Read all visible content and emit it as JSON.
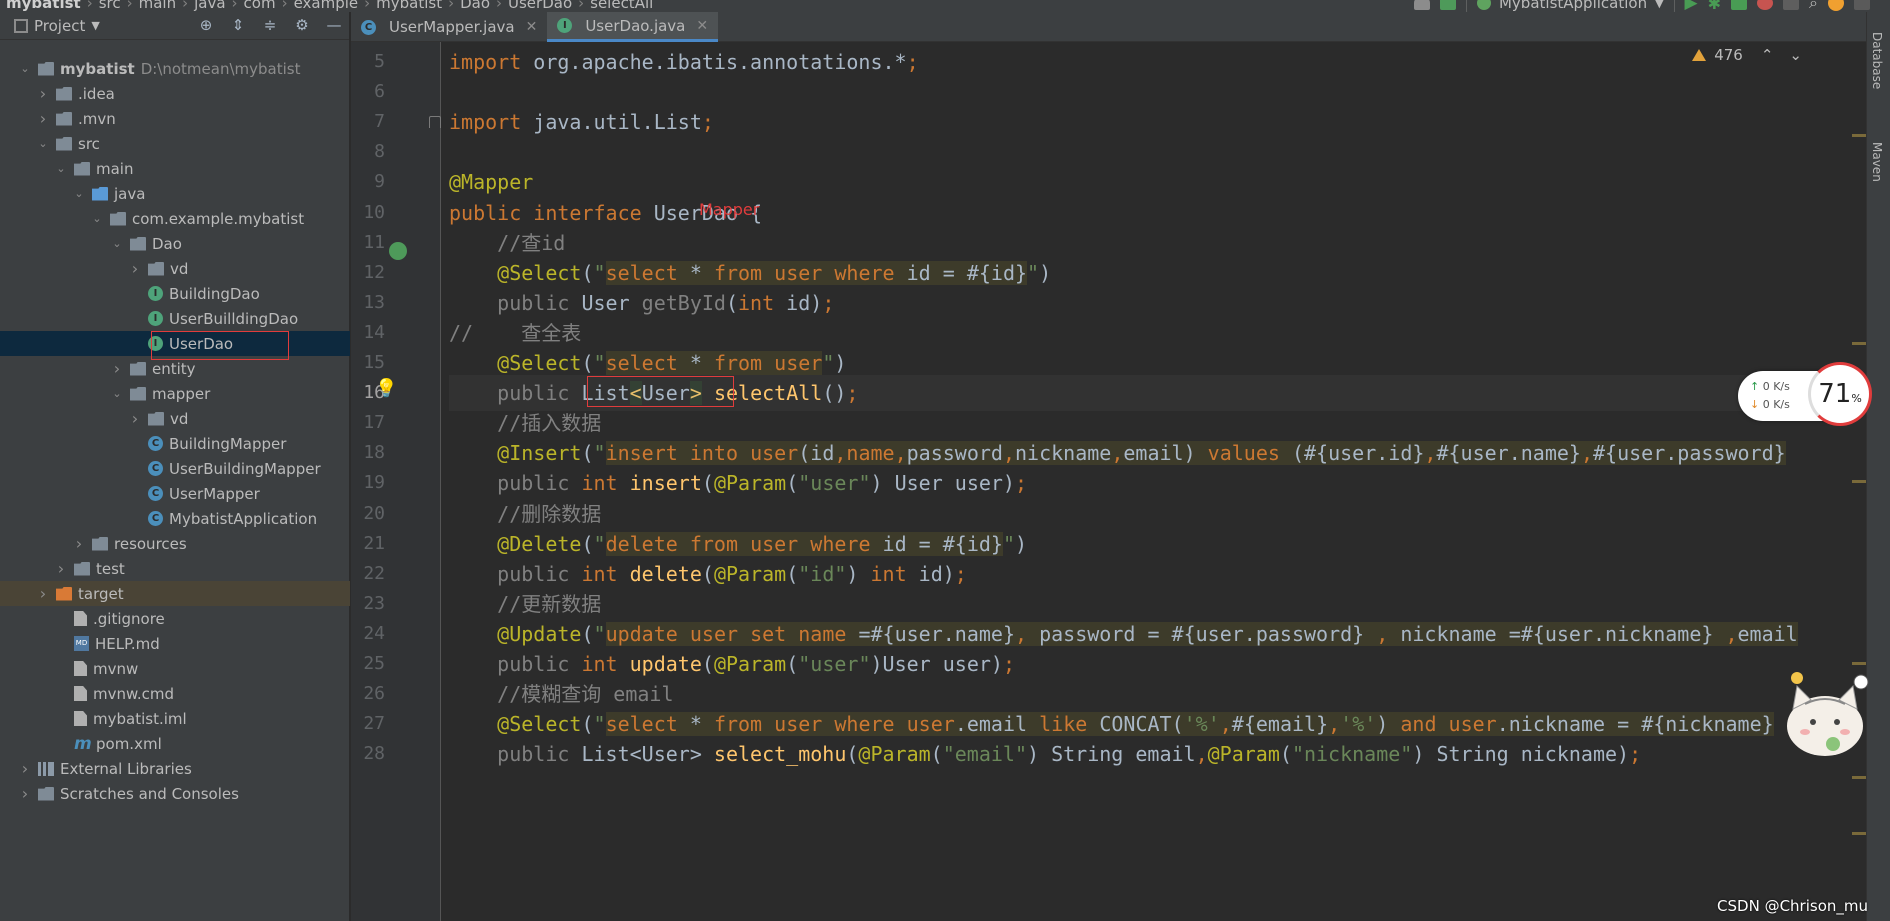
{
  "breadcrumb": [
    "mybatist",
    "src",
    "main",
    "java",
    "com",
    "example",
    "mybatist",
    "Dao",
    "UserDao",
    "selectAll"
  ],
  "run_config": "MybatistApplication",
  "project_panel": {
    "title": "Project",
    "tree": [
      {
        "label": "mybatist",
        "path": "D:\\notmean\\mybatist",
        "icon": "folder-gray",
        "depth": 0,
        "arrow": "down"
      },
      {
        "label": ".idea",
        "icon": "folder-gray",
        "depth": 1,
        "arrow": "right"
      },
      {
        "label": ".mvn",
        "icon": "folder-gray",
        "depth": 1,
        "arrow": "right"
      },
      {
        "label": "src",
        "icon": "folder-gray",
        "depth": 1,
        "arrow": "down"
      },
      {
        "label": "main",
        "icon": "folder-gray",
        "depth": 2,
        "arrow": "down"
      },
      {
        "label": "java",
        "icon": "folder-blue",
        "depth": 3,
        "arrow": "down"
      },
      {
        "label": "com.example.mybatist",
        "icon": "folder-gray",
        "depth": 4,
        "arrow": "down"
      },
      {
        "label": "Dao",
        "icon": "folder-gray",
        "depth": 5,
        "arrow": "down"
      },
      {
        "label": "vd",
        "icon": "folder-gray",
        "depth": 6,
        "arrow": "right"
      },
      {
        "label": "BuildingDao",
        "icon": "interface",
        "depth": 7,
        "arrow": ""
      },
      {
        "label": "UserBuilldingDao",
        "icon": "interface",
        "depth": 7,
        "arrow": ""
      },
      {
        "label": "UserDao",
        "icon": "interface",
        "depth": 7,
        "arrow": "",
        "selected": true
      },
      {
        "label": "entity",
        "icon": "folder-gray",
        "depth": 5,
        "arrow": "right"
      },
      {
        "label": "mapper",
        "icon": "folder-gray",
        "depth": 5,
        "arrow": "down"
      },
      {
        "label": "vd",
        "icon": "folder-gray",
        "depth": 6,
        "arrow": "right"
      },
      {
        "label": "BuildingMapper",
        "icon": "class",
        "depth": 7,
        "arrow": ""
      },
      {
        "label": "UserBuildingMapper",
        "icon": "class",
        "depth": 7,
        "arrow": ""
      },
      {
        "label": "UserMapper",
        "icon": "class",
        "depth": 7,
        "arrow": ""
      },
      {
        "label": "MybatistApplication",
        "icon": "app",
        "depth": 6,
        "arrow": ""
      },
      {
        "label": "resources",
        "icon": "folder-gray",
        "depth": 3,
        "arrow": "right"
      },
      {
        "label": "test",
        "icon": "folder-gray",
        "depth": 2,
        "arrow": "right"
      },
      {
        "label": "target",
        "icon": "folder-orange",
        "depth": 1,
        "arrow": "right",
        "target": true
      },
      {
        "label": ".gitignore",
        "icon": "file",
        "depth": 2,
        "arrow": ""
      },
      {
        "label": "HELP.md",
        "icon": "md",
        "depth": 2,
        "arrow": ""
      },
      {
        "label": "mvnw",
        "icon": "file",
        "depth": 2,
        "arrow": ""
      },
      {
        "label": "mvnw.cmd",
        "icon": "file",
        "depth": 2,
        "arrow": ""
      },
      {
        "label": "mybatist.iml",
        "icon": "file",
        "depth": 2,
        "arrow": ""
      },
      {
        "label": "pom.xml",
        "icon": "m",
        "depth": 2,
        "arrow": ""
      },
      {
        "label": "External Libraries",
        "icon": "lib",
        "depth": 0,
        "arrow": "right"
      },
      {
        "label": "Scratches and Consoles",
        "icon": "scratch",
        "depth": 0,
        "arrow": "right"
      }
    ]
  },
  "tabs": [
    {
      "label": "UserMapper.java",
      "icon": "class",
      "active": false
    },
    {
      "label": "UserDao.java",
      "icon": "interface",
      "active": true
    }
  ],
  "editor": {
    "warning_count": "476",
    "line_numbers": [
      "5",
      "6",
      "7",
      "8",
      "9",
      "10",
      "11",
      "12",
      "13",
      "14",
      "15",
      "16",
      "17",
      "18",
      "19",
      "20",
      "21",
      "22",
      "23",
      "24",
      "25",
      "26",
      "27",
      "28"
    ],
    "current_line": "16",
    "overlay_text": "Mapper"
  },
  "right_strip": [
    "Database",
    "Maven"
  ],
  "speed_widget": {
    "up": "0  K/s",
    "down": "0  K/s",
    "percent": "71",
    "percent_sign": "%"
  },
  "watermark": "CSDN @Chrison_mu",
  "colors": {
    "accent": "#4a88c7",
    "selection": "#0d293e",
    "highlight_box": "#e03c3c"
  }
}
